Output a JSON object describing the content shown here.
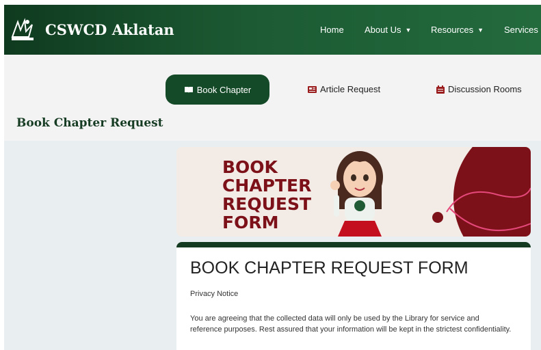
{
  "header": {
    "brand": "CSWCD Aklatan",
    "nav": {
      "home": "Home",
      "about": "About Us",
      "resources": "Resources",
      "services": "Services"
    }
  },
  "tabs": {
    "book_chapter": "Book Chapter",
    "article_request": "Article Request",
    "discussion_rooms": "Discussion Rooms"
  },
  "page_title": "Book Chapter Request",
  "banner": {
    "line1": "BOOK",
    "line2": "CHAPTER",
    "line3": "REQUEST",
    "line4": "FORM"
  },
  "form": {
    "title": "BOOK CHAPTER REQUEST FORM",
    "privacy_label": "Privacy Notice",
    "notice": "You are agreeing that the collected data will only be used by the Library for service and reference purposes. Rest assured that your information will be kept in the strictest confidentiality."
  },
  "colors": {
    "header_green": "#1c5a33",
    "active_pill": "#154a28",
    "banner_red": "#7c1119"
  }
}
